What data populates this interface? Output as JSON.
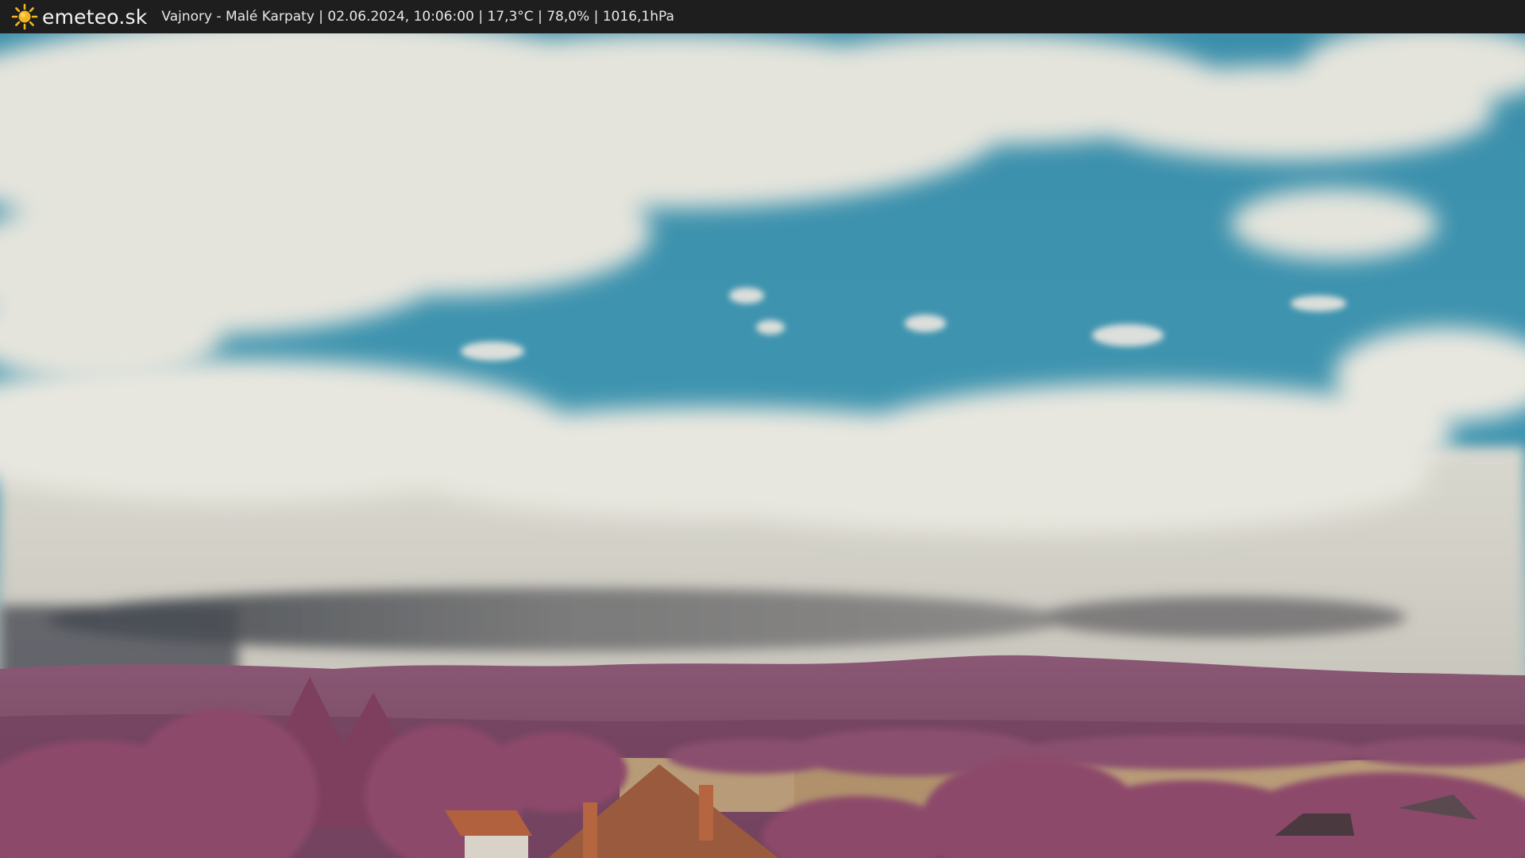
{
  "brand": "emeteo.sk",
  "logo_icon": "sun-icon",
  "info_line": "Vajnory - Malé Karpaty | 02.06.2024, 10:06:00 | 17,3°C | 78,0% | 1016,1hPa",
  "colors": {
    "bar": "#1e1e1e",
    "sky_blue": "#3f93ad",
    "cloud": "#e6e6dc",
    "hills": "#7c4a66",
    "field": "#b89b78",
    "sun": "#f5b422"
  }
}
